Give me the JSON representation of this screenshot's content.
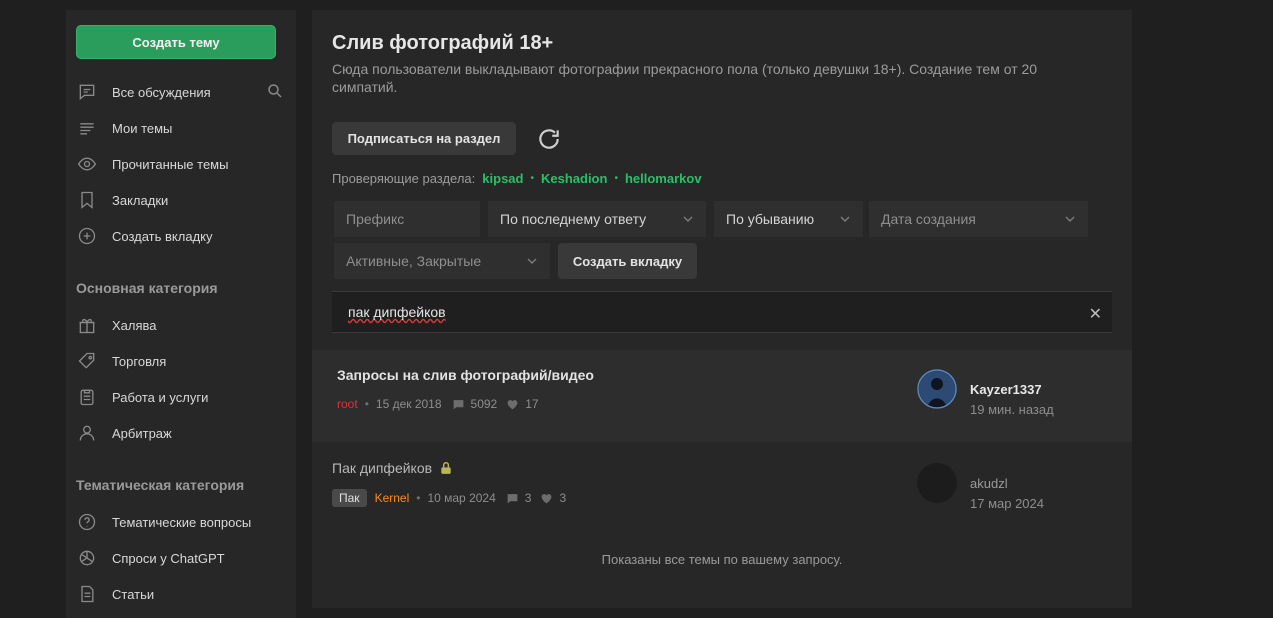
{
  "sidebar": {
    "create_label": "Создать тему",
    "items": [
      {
        "label": "Все обсуждения",
        "icon": "chat-icon"
      },
      {
        "label": "Мои темы",
        "icon": "list-icon"
      },
      {
        "label": "Прочитанные темы",
        "icon": "eye-icon"
      },
      {
        "label": "Закладки",
        "icon": "bookmark-icon"
      },
      {
        "label": "Создать вкладку",
        "icon": "plus-circle-icon"
      }
    ],
    "heading_main": "Основная категория",
    "main_items": [
      {
        "label": "Халява",
        "icon": "gift-icon"
      },
      {
        "label": "Торговля",
        "icon": "tag-icon"
      },
      {
        "label": "Работа и услуги",
        "icon": "clipboard-icon"
      },
      {
        "label": "Арбитраж",
        "icon": "user-icon"
      }
    ],
    "heading_theme": "Тематическая категория",
    "theme_items": [
      {
        "label": "Тематические вопросы",
        "icon": "question-icon"
      },
      {
        "label": "Спроси у ChatGPT",
        "icon": "chatgpt-icon"
      },
      {
        "label": "Статьи",
        "icon": "document-icon"
      }
    ]
  },
  "main": {
    "title": "Слив фотографий 18+",
    "description": "Сюда пользователи выкладывают фотографии прекрасного пола (только девушки 18+). Создание тем от 20 симпатий.",
    "subscribe_label": "Подписаться на раздел",
    "moderators_label": "Проверяющие раздела:",
    "moderators": [
      "kipsad",
      "Keshadion",
      "hellomarkov"
    ],
    "filters": {
      "prefix_placeholder": "Префикс",
      "sort_by": "По последнему ответу",
      "order": "По убыванию",
      "date_placeholder": "Дата создания",
      "state": "Активные, Закрытые",
      "create_tab_label": "Создать вкладку"
    },
    "search_value": "пак дипфейков",
    "clear_symbol": "✕",
    "threads": [
      {
        "title": "Запросы на слив фотографий/видео",
        "author": "root",
        "date": "15 дек 2018",
        "replies": "5092",
        "likes": "17",
        "last_user": "Kayzer1337",
        "last_time": "19 мин. назад"
      },
      {
        "title": "Пак дипфейков",
        "prefix": "Пак",
        "author": "Kernel",
        "date": "10 мар 2024",
        "replies": "3",
        "likes": "3",
        "last_user": "akudzl",
        "last_time": "17 мар 2024"
      }
    ],
    "footer_note": "Показаны все темы по вашему запросу."
  },
  "colors": {
    "accent": "#2a9d5c",
    "moderator": "#2bbf6a",
    "author_red": "#e0303a",
    "author_orange": "#ff8a1a"
  }
}
